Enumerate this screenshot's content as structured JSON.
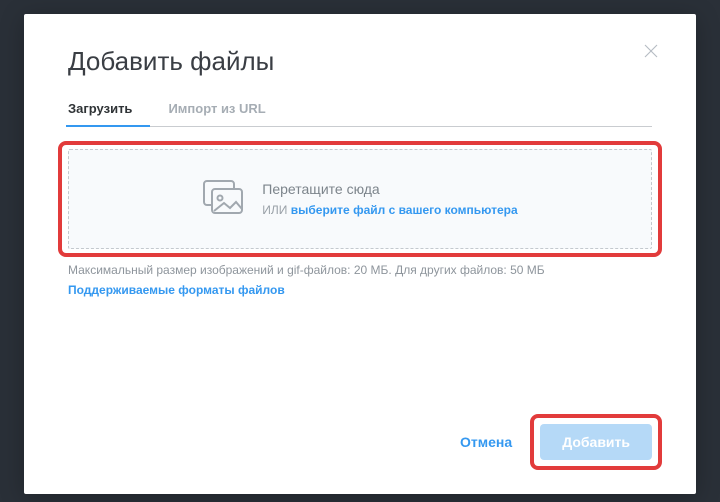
{
  "modal": {
    "title": "Добавить файлы",
    "tabs": [
      {
        "label": "Загрузить"
      },
      {
        "label": "Импорт из URL"
      }
    ],
    "dropzone": {
      "main": "Перетащите сюда",
      "or": "ИЛИ",
      "link": "выберите файл с вашего компьютера"
    },
    "hint": "Максимальный размер изображений и gif-файлов: 20 МБ. Для других файлов: 50 МБ",
    "formats_link": "Поддерживаемые форматы файлов",
    "cancel": "Отмена",
    "add": "Добавить"
  }
}
